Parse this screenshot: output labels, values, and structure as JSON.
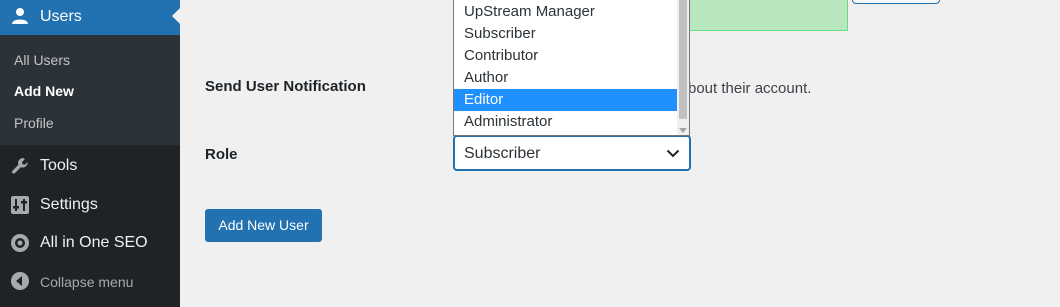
{
  "sidebar": {
    "users_label": "Users",
    "submenu": [
      "All Users",
      "Add New",
      "Profile"
    ],
    "tools_label": "Tools",
    "settings_label": "Settings",
    "seo_label": "All in One SEO",
    "collapse_label": "Collapse menu"
  },
  "form": {
    "notification_label": "Send User Notification",
    "notification_text": "bout their account.",
    "role_label": "Role",
    "role_value": "Subscriber",
    "role_options": [
      "UpStream Manager",
      "Subscriber",
      "Contributor",
      "Author",
      "Editor",
      "Administrator"
    ],
    "highlighted_option": "Editor",
    "submit_label": "Add New User"
  },
  "colors": {
    "sidebar_bg": "#1d2327",
    "accent": "#2271b1",
    "highlight": "#1e90ff",
    "success_bg": "#b8e6bf"
  }
}
